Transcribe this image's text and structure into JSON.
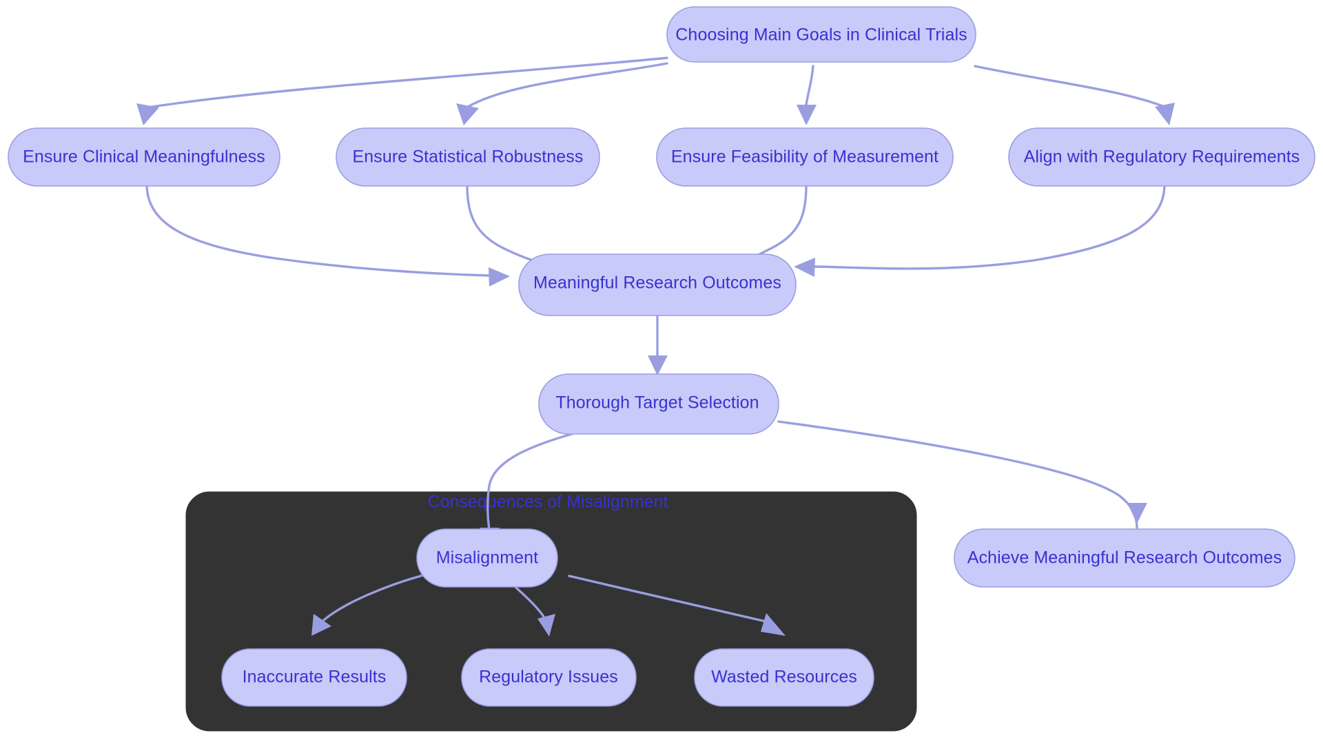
{
  "diagram": {
    "type": "flowchart",
    "title": "Choosing Main Goals in Clinical Trials",
    "direction": "top-down",
    "background_color": "#ffffff",
    "node_fill_color": "#c8caf9",
    "node_border_color": "#9a9ee0",
    "node_text_color": "#3832cf",
    "edge_color": "#9a9ee0",
    "cluster_fill_color": "#333333",
    "cluster_title_color": "#3832cf",
    "nodes": {
      "root": {
        "label": "Choosing Main Goals in Clinical Trials"
      },
      "clinical": {
        "label": "Ensure Clinical Meaningfulness"
      },
      "statistical": {
        "label": "Ensure Statistical Robustness"
      },
      "feasibility": {
        "label": "Ensure Feasibility of Measurement"
      },
      "regulatory": {
        "label": "Align with Regulatory Requirements"
      },
      "outcomes": {
        "label": "Meaningful Research Outcomes"
      },
      "selection": {
        "label": "Thorough Target Selection"
      },
      "achieve": {
        "label": "Achieve Meaningful Research Outcomes"
      },
      "misalignment": {
        "label": "Misalignment"
      },
      "inaccurate": {
        "label": "Inaccurate Results"
      },
      "regissues": {
        "label": "Regulatory Issues"
      },
      "wasted": {
        "label": "Wasted Resources"
      }
    },
    "cluster": {
      "label": "Consequences of Misalignment"
    },
    "edges": [
      {
        "from": "root",
        "to": "clinical"
      },
      {
        "from": "root",
        "to": "statistical"
      },
      {
        "from": "root",
        "to": "feasibility"
      },
      {
        "from": "root",
        "to": "regulatory"
      },
      {
        "from": "clinical",
        "to": "outcomes"
      },
      {
        "from": "statistical",
        "to": "outcomes"
      },
      {
        "from": "feasibility",
        "to": "outcomes"
      },
      {
        "from": "regulatory",
        "to": "outcomes"
      },
      {
        "from": "outcomes",
        "to": "selection"
      },
      {
        "from": "selection",
        "to": "misalignment"
      },
      {
        "from": "selection",
        "to": "achieve"
      },
      {
        "from": "misalignment",
        "to": "inaccurate"
      },
      {
        "from": "misalignment",
        "to": "regissues"
      },
      {
        "from": "misalignment",
        "to": "wasted"
      }
    ]
  }
}
